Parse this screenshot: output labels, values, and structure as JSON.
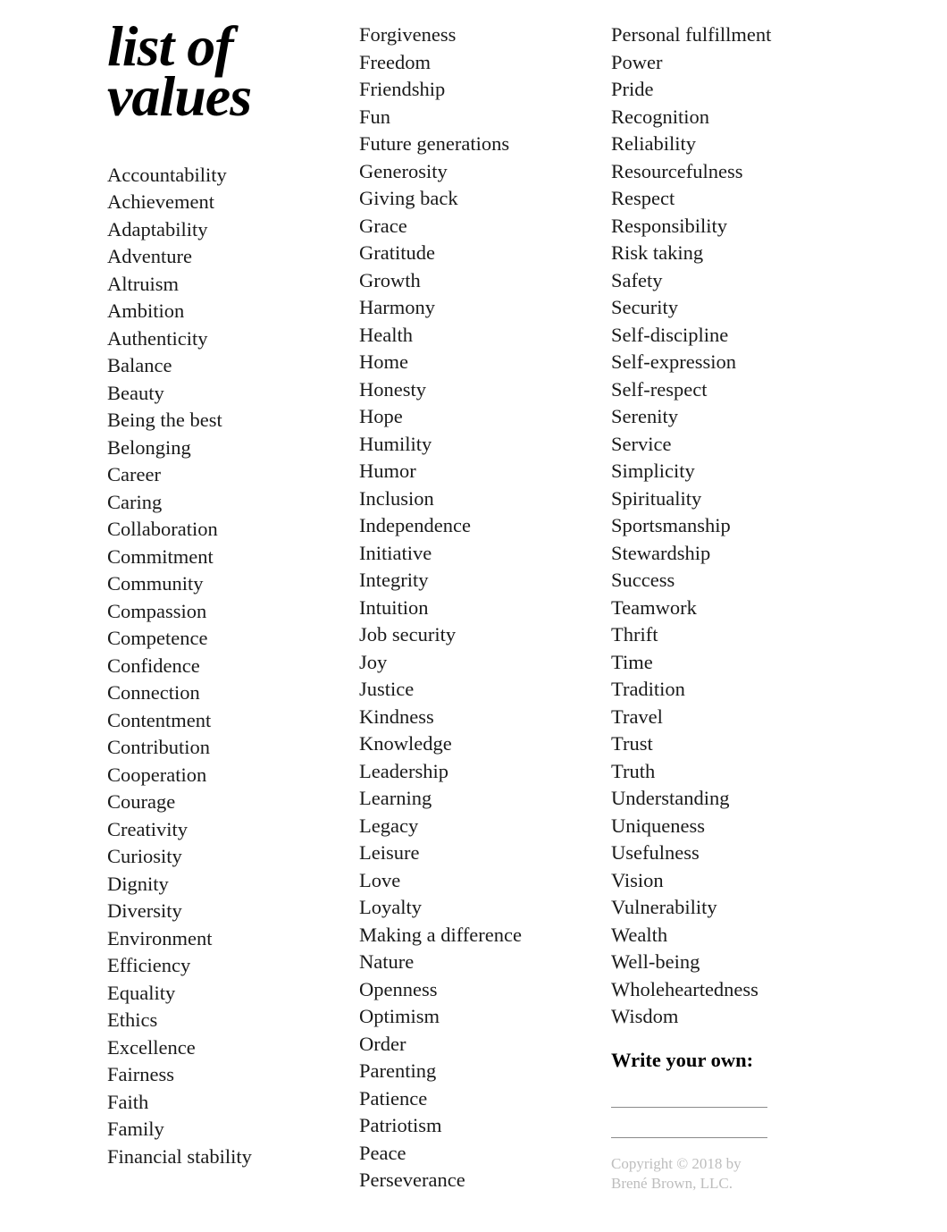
{
  "title_line1": "list of",
  "title_line2": "values",
  "columns": {
    "col1": [
      "Accountability",
      "Achievement",
      "Adaptability",
      "Adventure",
      "Altruism",
      "Ambition",
      "Authenticity",
      "Balance",
      "Beauty",
      "Being the best",
      "Belonging",
      "Career",
      "Caring",
      "Collaboration",
      "Commitment",
      "Community",
      "Compassion",
      "Competence",
      "Confidence",
      "Connection",
      "Contentment",
      "Contribution",
      "Cooperation",
      "Courage",
      "Creativity",
      "Curiosity",
      "Dignity",
      "Diversity",
      "Environment",
      "Efficiency",
      "Equality",
      "Ethics",
      "Excellence",
      "Fairness",
      "Faith",
      "Family",
      "Financial stability"
    ],
    "col2": [
      "Forgiveness",
      "Freedom",
      "Friendship",
      "Fun",
      "Future generations",
      "Generosity",
      "Giving back",
      "Grace",
      "Gratitude",
      "Growth",
      "Harmony",
      "Health",
      "Home",
      "Honesty",
      "Hope",
      "Humility",
      "Humor",
      "Inclusion",
      "Independence",
      "Initiative",
      "Integrity",
      "Intuition",
      "Job security",
      "Joy",
      "Justice",
      "Kindness",
      "Knowledge",
      "Leadership",
      "Learning",
      "Legacy",
      "Leisure",
      "Love",
      "Loyalty",
      "Making a difference",
      "Nature",
      "Openness",
      "Optimism",
      "Order",
      "Parenting",
      "Patience",
      "Patriotism",
      "Peace",
      "Perseverance"
    ],
    "col3": [
      "Personal fulfillment",
      "Power",
      "Pride",
      "Recognition",
      "Reliability",
      "Resourcefulness",
      "Respect",
      "Responsibility",
      "Risk taking",
      "Safety",
      "Security",
      "Self-discipline",
      "Self-expression",
      "Self-respect",
      "Serenity",
      "Service",
      "Simplicity",
      "Spirituality",
      "Sportsmanship",
      "Stewardship",
      "Success",
      "Teamwork",
      "Thrift",
      "Time",
      "Tradition",
      "Travel",
      "Trust",
      "Truth",
      "Understanding",
      "Uniqueness",
      "Usefulness",
      "Vision",
      "Vulnerability",
      "Wealth",
      "Well-being",
      "Wholeheartedness",
      "Wisdom"
    ]
  },
  "write_own_label": "Write your own:",
  "copyright_line1": "Copyright © 2018 by",
  "copyright_line2": "Brené Brown, LLC."
}
